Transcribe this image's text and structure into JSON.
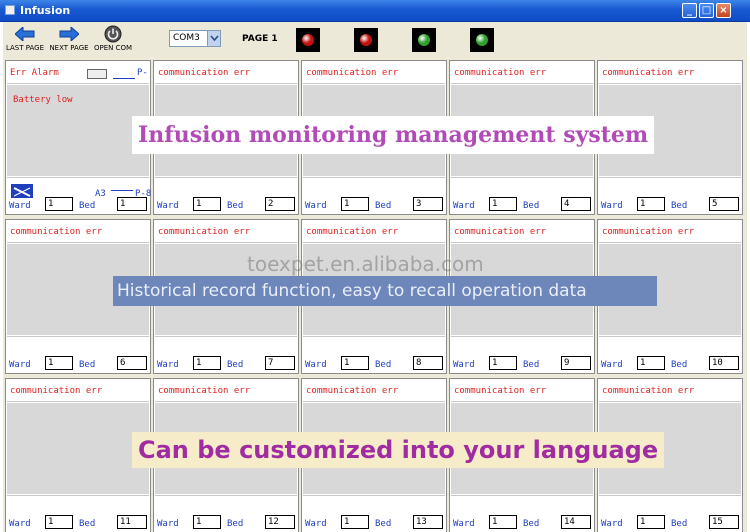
{
  "window": {
    "title": "Infusion",
    "minimize": "_",
    "maximize": "□",
    "close": "×"
  },
  "toolbar": {
    "last_page": "LAST PAGE",
    "next_page": "NEXT PAGE",
    "open_com": "OPEN COM",
    "com_port": "COM3",
    "page_label": "PAGE 1",
    "lamps": [
      {
        "color": "#c41010"
      },
      {
        "color": "#c41010"
      },
      {
        "color": "#2da02d"
      },
      {
        "color": "#2da02d"
      }
    ]
  },
  "labels": {
    "ward": "Ward",
    "bed": "Bed"
  },
  "cell1": {
    "alarm": "Err Alarm",
    "p_top": "P-",
    "status": "Battery low",
    "area": "A3",
    "p_bottom": "P-8"
  },
  "cells": [
    {
      "status": "",
      "ward": "1",
      "bed": "1"
    },
    {
      "status": "communication err",
      "ward": "1",
      "bed": "2"
    },
    {
      "status": "communication err",
      "ward": "1",
      "bed": "3"
    },
    {
      "status": "communication err",
      "ward": "1",
      "bed": "4"
    },
    {
      "status": "communication err",
      "ward": "1",
      "bed": "5"
    },
    {
      "status": "communication err",
      "ward": "1",
      "bed": "6"
    },
    {
      "status": "communication err",
      "ward": "1",
      "bed": "7"
    },
    {
      "status": "communication err",
      "ward": "1",
      "bed": "8"
    },
    {
      "status": "communication err",
      "ward": "1",
      "bed": "9"
    },
    {
      "status": "communication err",
      "ward": "1",
      "bed": "10"
    },
    {
      "status": "communication err",
      "ward": "1",
      "bed": "11"
    },
    {
      "status": "communication err",
      "ward": "1",
      "bed": "12"
    },
    {
      "status": "communication err",
      "ward": "1",
      "bed": "13"
    },
    {
      "status": "communication err",
      "ward": "1",
      "bed": "14"
    },
    {
      "status": "communication err",
      "ward": "1",
      "bed": "15"
    }
  ],
  "overlays": {
    "title": "Infusion monitoring management system",
    "history": "Historical record function, easy to recall operation data",
    "language": "Can be customized into your language",
    "watermark": "toexpet.en.alibaba.com"
  }
}
